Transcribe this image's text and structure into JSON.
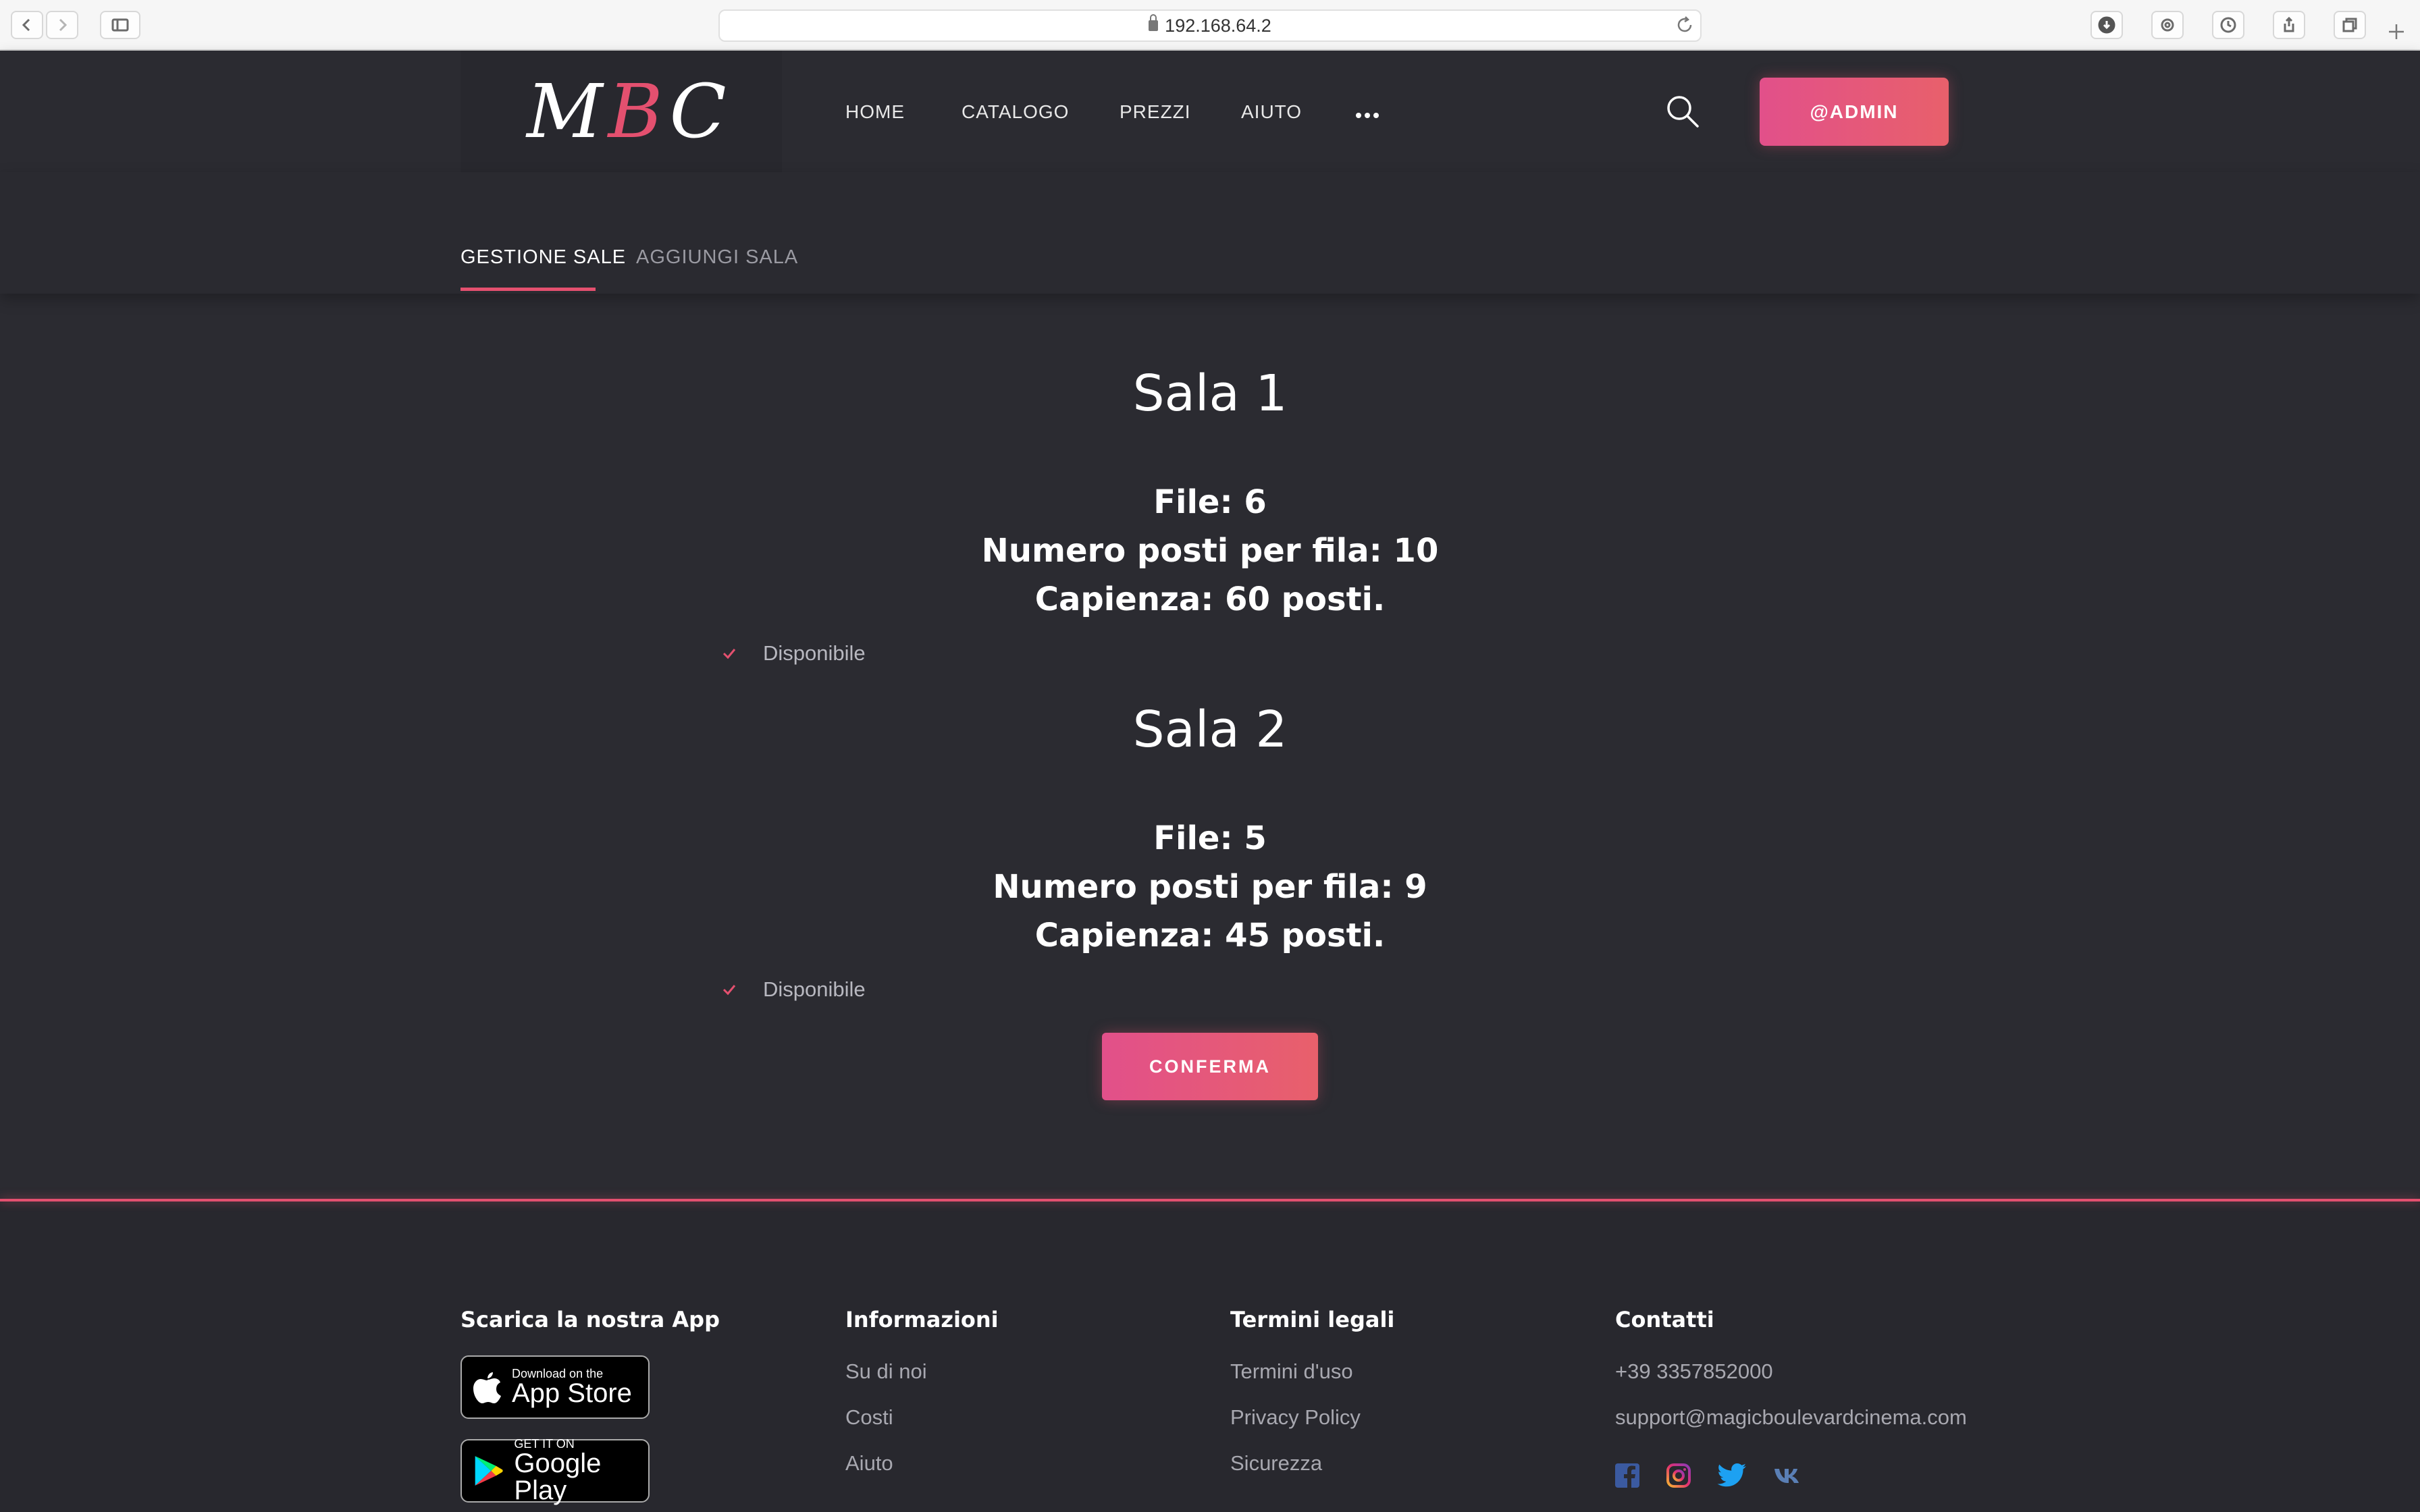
{
  "browser": {
    "url": "192.168.64.2"
  },
  "header": {
    "logo": {
      "m": "M",
      "b": "B",
      "c": "C"
    },
    "nav": [
      "HOME",
      "CATALOGO",
      "PREZZI",
      "AIUTO"
    ],
    "admin_label": "@ADMIN"
  },
  "tabs": {
    "active": "GESTIONE SALE",
    "other": "AGGIUNGI SALA"
  },
  "rooms": [
    {
      "title": "Sala 1",
      "file": "File: 6",
      "posti": "Numero posti per fila: 10",
      "capienza": "Capienza: 60 posti.",
      "status": "Disponibile"
    },
    {
      "title": "Sala 2",
      "file": "File: 5",
      "posti": "Numero posti per fila: 9",
      "capienza": "Capienza: 45 posti.",
      "status": "Disponibile"
    }
  ],
  "confirm_label": "CONFERMA",
  "footer": {
    "app": {
      "heading": "Scarica la nostra App",
      "appstore_small": "Download on the",
      "appstore_big": "App Store",
      "gplay_small": "GET IT ON",
      "gplay_big": "Google Play"
    },
    "info": {
      "heading": "Informazioni",
      "links": [
        "Su di noi",
        "Costi",
        "Aiuto"
      ]
    },
    "legal": {
      "heading": "Termini legali",
      "links": [
        "Termini d'uso",
        "Privacy Policy",
        "Sicurezza"
      ]
    },
    "contacts": {
      "heading": "Contatti",
      "phone": "+39 3357852000",
      "email": "support@magicboulevardcinema.com",
      "social": [
        "facebook-icon",
        "instagram-icon",
        "twitter-icon",
        "vk-icon"
      ]
    }
  },
  "colors": {
    "accent": "#e4506f",
    "background": "#2b2b31"
  }
}
